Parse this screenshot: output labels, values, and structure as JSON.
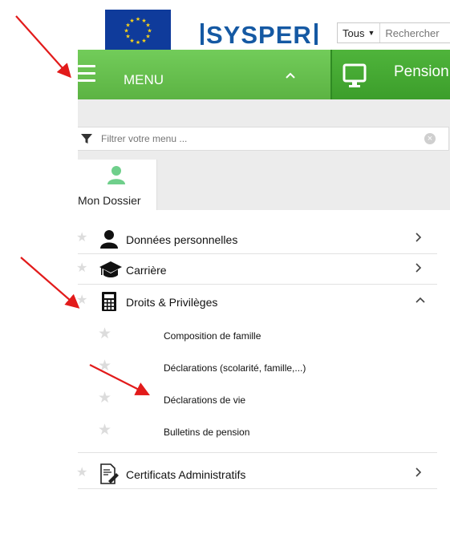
{
  "header": {
    "brand": "SYSPER",
    "search_scope": "Tous",
    "search_placeholder": "Rechercher"
  },
  "menubar": {
    "menu_label": "MENU",
    "module_label": "Pension"
  },
  "filter": {
    "placeholder": "Filtrer votre menu ..."
  },
  "tabs": [
    {
      "label": "Mon Dossier",
      "icon": "person-icon",
      "active": true
    }
  ],
  "menu_items": [
    {
      "label": "Données personnelles",
      "icon": "person-icon",
      "expanded": false
    },
    {
      "label": "Carrière",
      "icon": "graduation-cap-icon",
      "expanded": false
    },
    {
      "label": "Droits & Privilèges",
      "icon": "calculator-icon",
      "expanded": true,
      "children": [
        {
          "label": "Composition de famille"
        },
        {
          "label": "Déclarations (scolarité, famille,...)"
        },
        {
          "label": "Déclarations de vie"
        },
        {
          "label": "Bulletins de pension"
        }
      ]
    },
    {
      "label": "Certificats Administratifs",
      "icon": "certificate-icon",
      "expanded": false
    }
  ],
  "colors": {
    "menu_green": "#5cb343",
    "module_green": "#3c9e2b",
    "brand_blue": "#1559a3",
    "eu_blue": "#0f3b9b",
    "eu_gold": "#ffd617",
    "annotation_red": "#e21b1b"
  }
}
